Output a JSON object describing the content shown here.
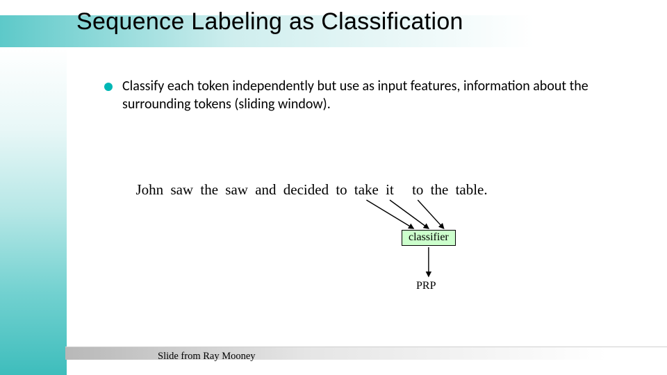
{
  "title": "Sequence Labeling as Classification",
  "bullet": {
    "text": "Classify each token independently but use as input features, information about the surrounding tokens (sliding window)."
  },
  "sentence": {
    "words": [
      "John",
      "saw",
      "the",
      "saw",
      "and",
      "decided",
      "to",
      "take",
      "it",
      "to",
      "the",
      "table."
    ]
  },
  "classifier": {
    "label": "classifier",
    "output_tag": "PRP",
    "input_indices": [
      7,
      8,
      9
    ]
  },
  "attribution": "Slide from Ray Mooney",
  "colors": {
    "accent": "#00b7b5",
    "classifier_bg": "#ccffcc"
  }
}
